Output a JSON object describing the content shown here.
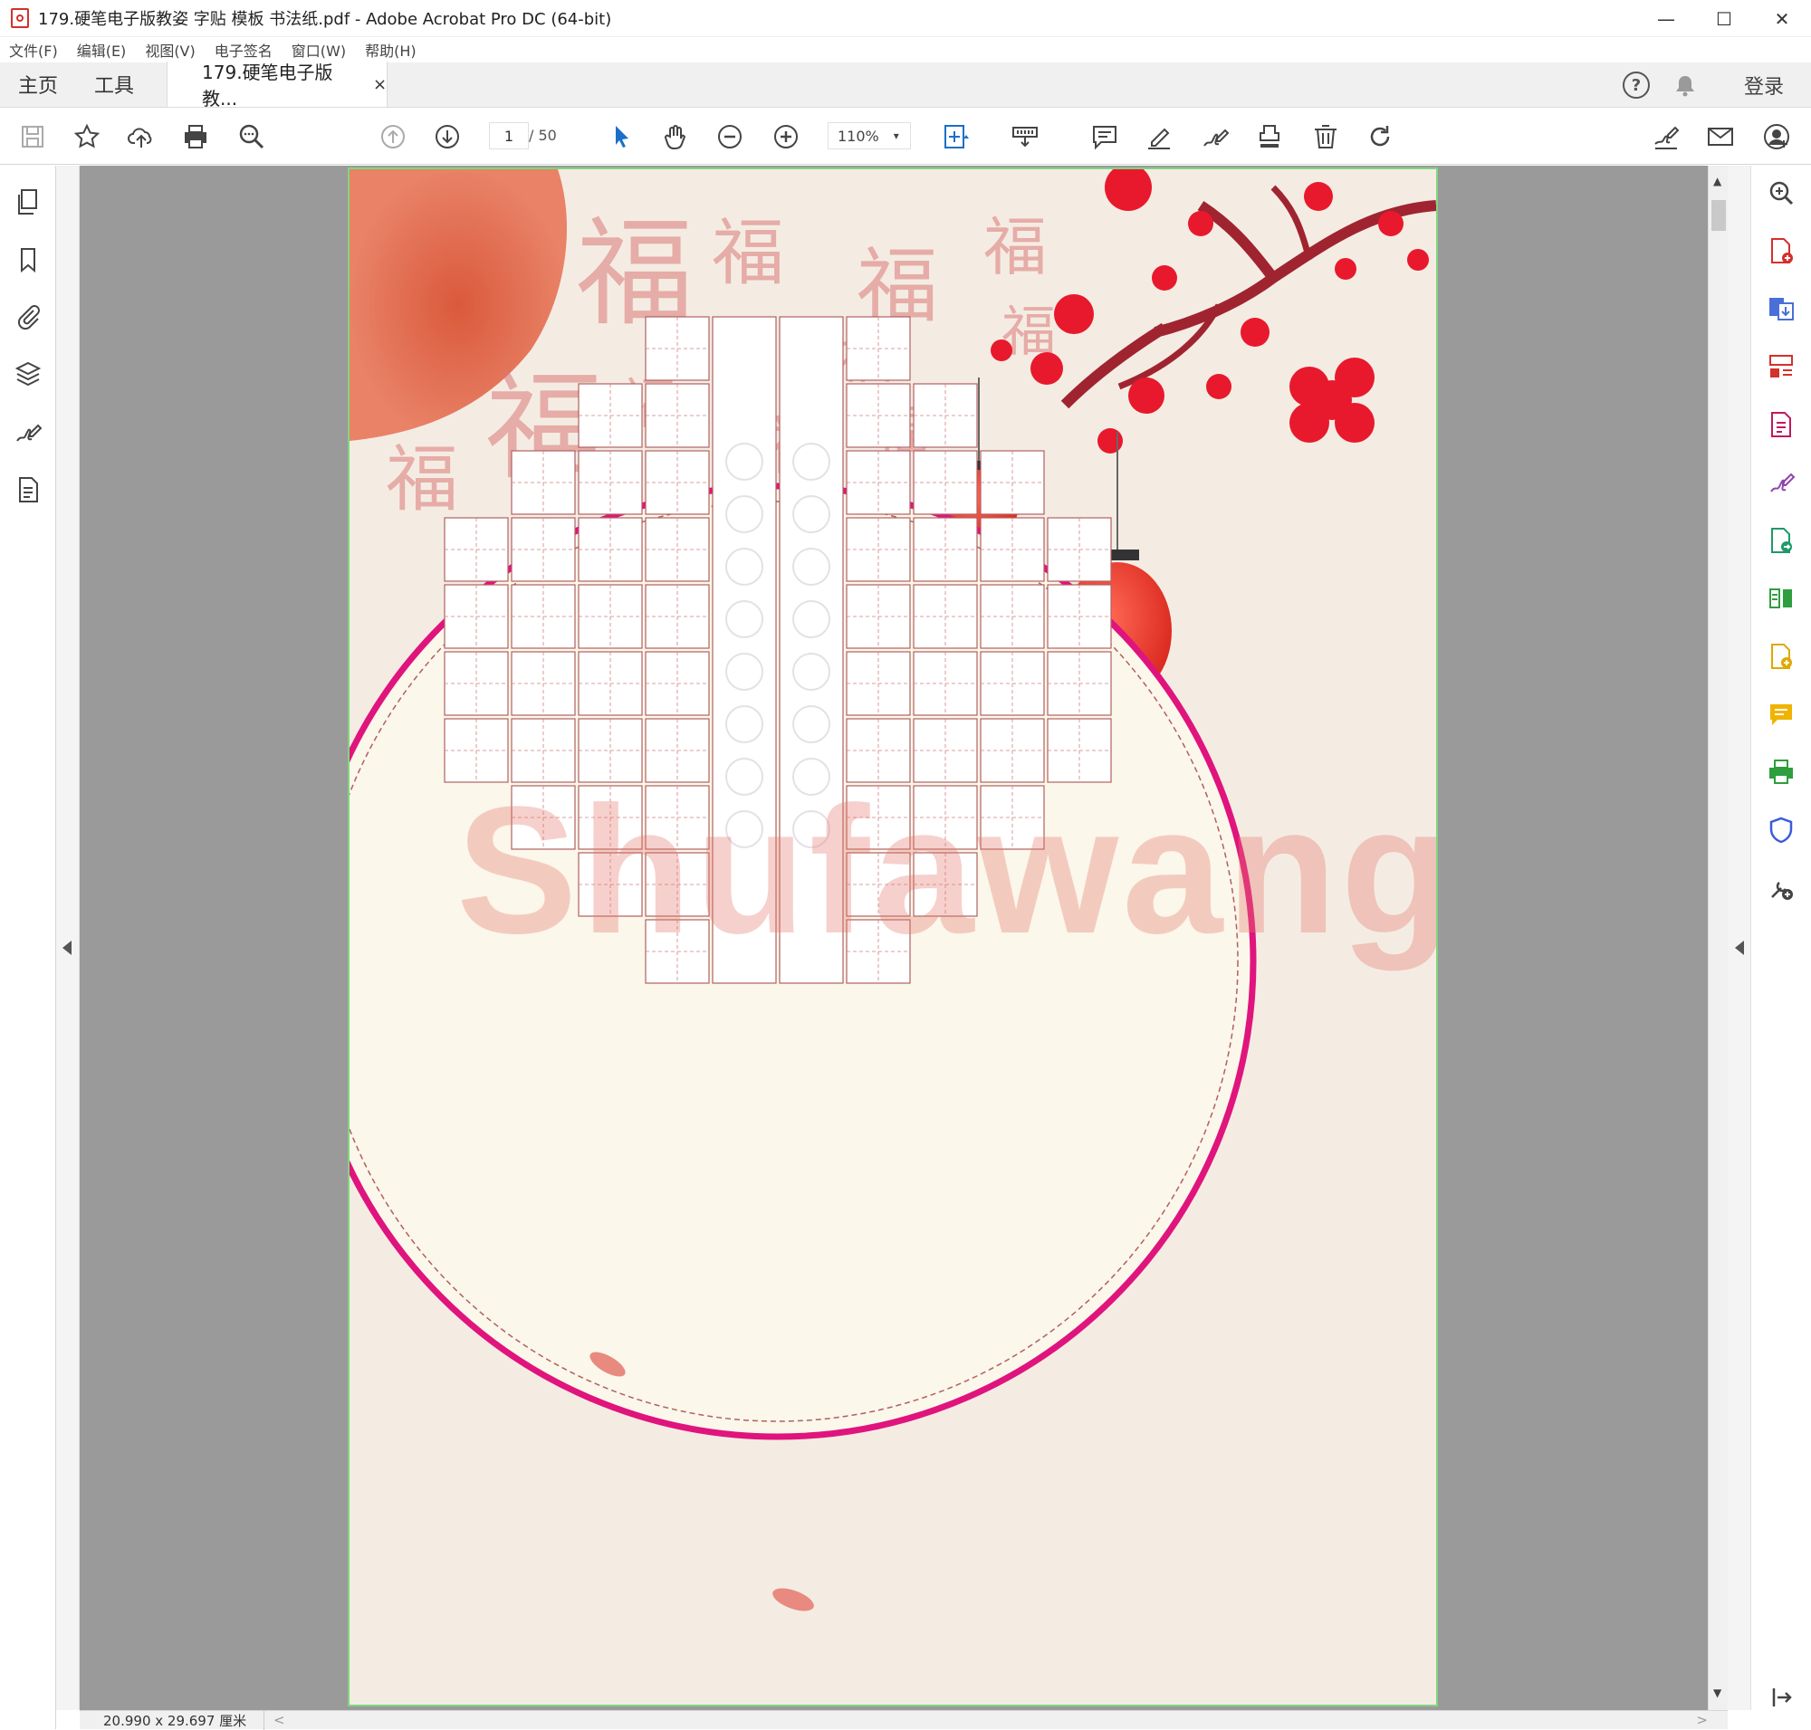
{
  "window": {
    "title": "179.硬笔电子版教姿 字贴 模板 书法纸.pdf - Adobe Acrobat Pro DC (64-bit)",
    "minimize": "—",
    "maximize": "☐",
    "close": "✕"
  },
  "menu": [
    "文件(F)",
    "编辑(E)",
    "视图(V)",
    "电子签名",
    "窗口(W)",
    "帮助(H)"
  ],
  "tabs": {
    "home": "主页",
    "tools": "工具",
    "document": "179.硬笔电子版教...",
    "document_close": "×",
    "help": "?",
    "login": "登录"
  },
  "toolbar": {
    "page_current": "1",
    "page_total": "/ 50",
    "zoom": "110%",
    "zoom_caret": "▾"
  },
  "document": {
    "watermark": "Shufawang.CN",
    "colors": {
      "ring": "#e0147d",
      "grid": "#b06060",
      "lantern": "#e8322a",
      "blossom": "#e8192c"
    }
  },
  "status": {
    "page_size": "20.990 x 29.697 厘米",
    "scroll_left": "<",
    "scroll_right": ">"
  },
  "scroll": {
    "up": "▲",
    "down": "▼"
  }
}
